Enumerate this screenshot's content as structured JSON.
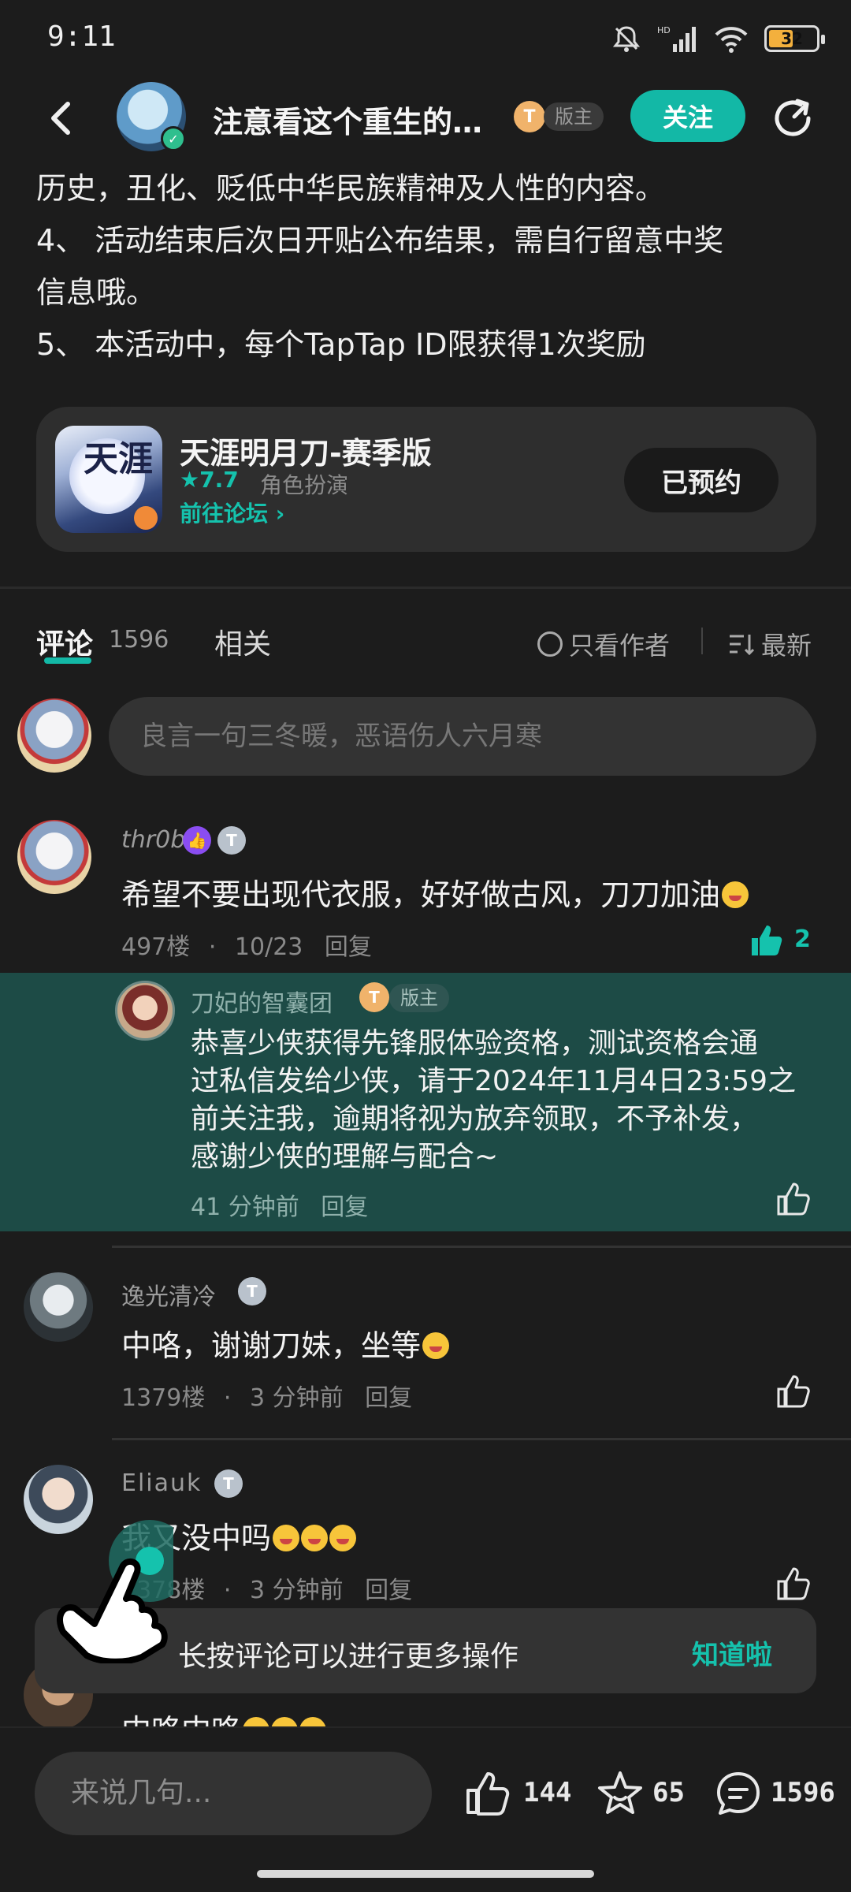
{
  "status_bar": {
    "time": "9:11",
    "battery": "32"
  },
  "header": {
    "title": "注意看这个重生的…",
    "badge_letter": "T",
    "role": "版主",
    "follow": "关注"
  },
  "article": {
    "lines": [
      "历史，丑化、贬低中华民族精神及人性的内容。",
      "4、 活动结束后次日开贴公布结果，需自行留意中奖",
      "信息哦。",
      "5、 本活动中，每个TapTap ID限获得1次奖励"
    ]
  },
  "game_card": {
    "name": "天涯明月刀-赛季版",
    "rating": "★7.7",
    "category": "角色扮演",
    "forum_link": "前往论坛 ›",
    "reserved": "已预约",
    "icon_text": "天涯"
  },
  "tabs": {
    "comment": "评论",
    "comment_count": "1596",
    "related": "相关",
    "only_author": "只看作者",
    "sort": "最新"
  },
  "comment_input": {
    "placeholder": "良言一句三冬暖，恶语伤人六月寒"
  },
  "comments": [
    {
      "user": "thr0b",
      "text": "希望不要出现代衣服，好好做古风，刀刀加油",
      "floor": "497楼",
      "date": "10/23",
      "reply": "回复",
      "likes": "2"
    },
    {
      "user": "逸光清冷",
      "text": "中咯，谢谢刀妹，坐等",
      "floor": "1379楼",
      "date": "3 分钟前",
      "reply": "回复"
    },
    {
      "user": "Eliauk",
      "text": "我又没中吗",
      "floor": "1378楼",
      "date": "3 分钟前",
      "reply": "回复"
    },
    {
      "user": "",
      "text": "中咯中咯",
      "floor": "",
      "date": "",
      "reply": ""
    }
  ],
  "official_reply": {
    "user": "刀妃的智囊团",
    "badge_letter": "T",
    "role": "版主",
    "lines": [
      "恭喜少侠获得先锋服体验资格，测试资格会通",
      "过私信发给少侠，请于2024年11月4日23:59之",
      "前关注我，逾期将视为放弃领取，不予补发，",
      "感谢少侠的理解与配合~"
    ],
    "time": "41 分钟前",
    "reply": "回复"
  },
  "tooltip": {
    "message": "长按评论可以进行更多操作",
    "ok": "知道啦"
  },
  "bottom_bar": {
    "say_placeholder": "来说几句...",
    "likes": "144",
    "favorites": "65",
    "comments": "1596"
  },
  "colors": {
    "accent": "#13b8a6",
    "background": "#1c1c1c",
    "reply_bg": "#1d4b46"
  },
  "icons": [
    "back-icon",
    "share-icon",
    "thumb-up-icon",
    "star-icon",
    "comment-icon",
    "mute-icon",
    "signal-icon",
    "wifi-icon",
    "battery-icon",
    "hand-pointer-icon"
  ]
}
